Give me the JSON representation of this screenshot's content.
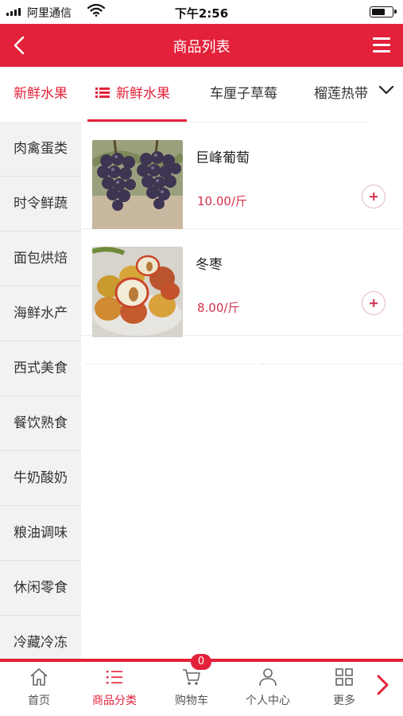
{
  "status_bar": {
    "carrier": "阿里通信",
    "time": "下午2:56"
  },
  "header": {
    "title": "商品列表"
  },
  "sidebar": {
    "items": [
      {
        "label": "新鲜水果",
        "active": true
      },
      {
        "label": "肉禽蛋类"
      },
      {
        "label": "时令鲜蔬"
      },
      {
        "label": "面包烘焙"
      },
      {
        "label": "海鲜水产"
      },
      {
        "label": "西式美食"
      },
      {
        "label": "餐饮熟食"
      },
      {
        "label": "牛奶酸奶"
      },
      {
        "label": "粮油调味"
      },
      {
        "label": "休闲零食"
      },
      {
        "label": "冷藏冷冻"
      }
    ]
  },
  "tabs": [
    {
      "label": "新鲜水果",
      "active": true
    },
    {
      "label": "车厘子草莓"
    },
    {
      "label": "榴莲热带"
    }
  ],
  "products": [
    {
      "name": "巨峰葡萄",
      "price": "10.00/斤",
      "image": "grapes"
    },
    {
      "name": "冬枣",
      "price": "8.00/斤",
      "image": "winter-jujube"
    }
  ],
  "bottom_nav": {
    "items": [
      {
        "label": "首页",
        "icon": "home-icon"
      },
      {
        "label": "商品分类",
        "icon": "list-icon",
        "active": true
      },
      {
        "label": "购物车",
        "icon": "cart-icon"
      },
      {
        "label": "个人中心",
        "icon": "user-icon"
      },
      {
        "label": "更多",
        "icon": "grid-icon"
      }
    ],
    "cart_count": "0"
  },
  "colors": {
    "accent": "#e3213a",
    "price": "#d0314a"
  }
}
